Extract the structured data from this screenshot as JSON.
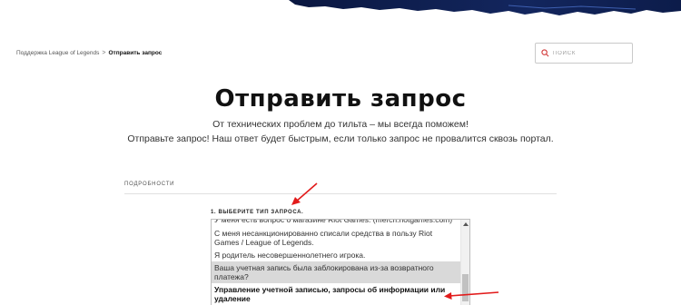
{
  "breadcrumb": {
    "parent": "Поддержка League of Legends",
    "separator": ">",
    "current": "Отправить запрос"
  },
  "search": {
    "placeholder": "ПОИСК",
    "icon": "search-icon"
  },
  "header": {
    "title": "Отправить запрос",
    "subtitle_line1": "От технических проблем до тильта – мы всегда поможем!",
    "subtitle_line2": "Отправьте запрос! Наш ответ будет быстрым, если только запрос не провалится сквозь портал."
  },
  "form": {
    "section_label": "ПОДРОБНОСТИ",
    "request_type_label": "1. ВЫБЕРИТЕ ТИП ЗАПРОСА.",
    "options": [
      "У меня есть вопрос о магазине Riot Games. (merch.riotgames.com)",
      "С меня несанкционированно списали средства в пользу Riot Games / League of Legends.",
      "Я родитель несовершеннолетнего игрока.",
      "Ваша учетная запись была заблокирована из-за возвратного платежа?",
      "Управление учетной записью, запросы об информации или удаление"
    ],
    "highlighted_option_index": 3,
    "selected_option_index": 4
  },
  "colors": {
    "banner": "#0c1c4a",
    "annotation_arrow": "#e21b1b",
    "highlight": "#d9d9d9"
  }
}
